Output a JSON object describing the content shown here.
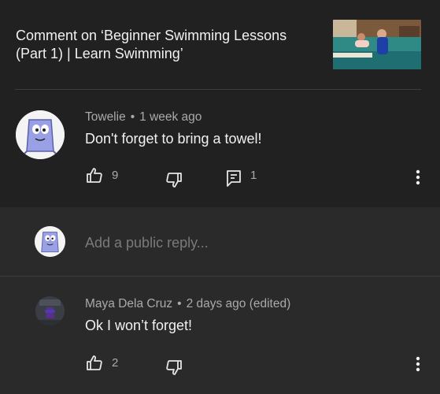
{
  "header": {
    "title": "Comment on ‘Beginner Swimming Lessons (Part 1) | Learn Swimming’"
  },
  "comment": {
    "author": "Towelie",
    "separator": "•",
    "time": "1 week ago",
    "text": "Don't forget to bring a towel!",
    "likes": "9",
    "replies": "1",
    "avatar_icon": "towelie-avatar"
  },
  "reply_box": {
    "placeholder": "Add a public reply..."
  },
  "reply": {
    "author": "Maya Dela Cruz",
    "separator": "•",
    "time": "2 days ago (edited)",
    "text": "Ok I won’t forget!",
    "likes": "2"
  },
  "colors": {
    "background": "#212121",
    "panel": "#2a2a2a",
    "text_primary": "#f1f1f1",
    "text_secondary": "#aaaaaa"
  }
}
